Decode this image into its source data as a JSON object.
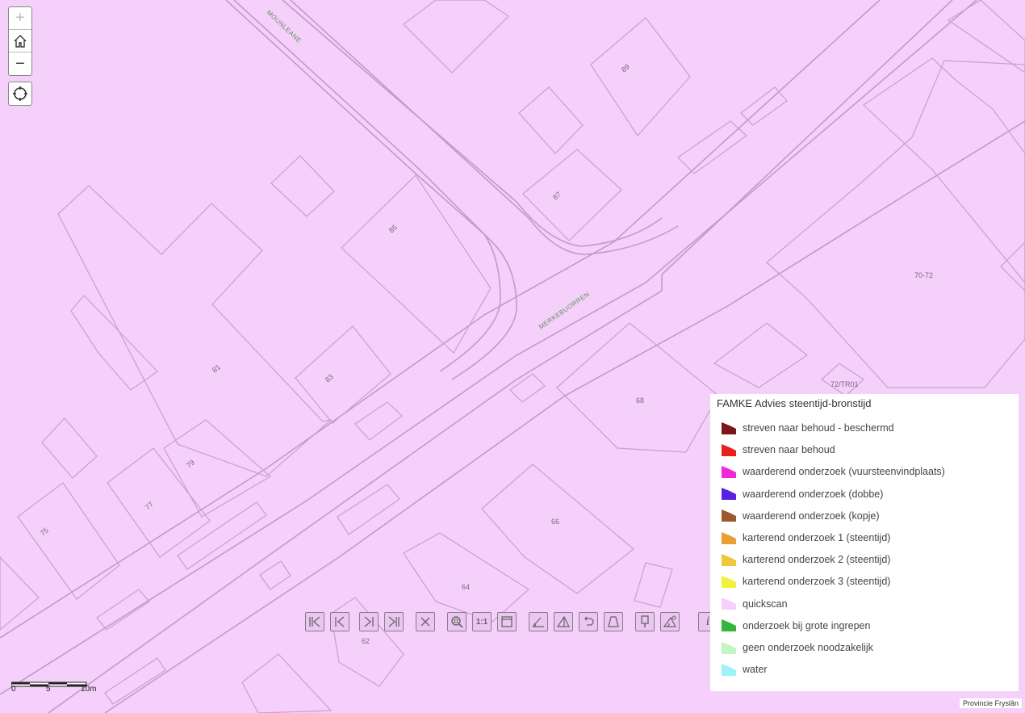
{
  "map": {
    "streets": [
      {
        "label": "MOUNLEANE"
      },
      {
        "label": "MERKEBUORREN"
      }
    ],
    "house_numbers": [
      "89",
      "87",
      "85",
      "81",
      "83",
      "79",
      "77",
      "75",
      "68",
      "66",
      "64",
      "62",
      "70-72",
      "72/TR01"
    ]
  },
  "controls": {
    "zoom_in": "+",
    "zoom_out": "−"
  },
  "toolbar": {
    "tools": [
      {
        "name": "first-extent-icon"
      },
      {
        "name": "previous-extent-icon"
      },
      {
        "name": "next-extent-icon"
      },
      {
        "name": "last-extent-icon"
      },
      {
        "name": "clear-icon"
      },
      {
        "name": "zoom-area-icon"
      },
      {
        "name": "scale-1to1-icon",
        "label": "1:1"
      },
      {
        "name": "full-extent-icon"
      },
      {
        "name": "measure-distance-icon"
      },
      {
        "name": "measure-area-icon"
      },
      {
        "name": "undo-icon"
      },
      {
        "name": "draw-polygon-icon"
      },
      {
        "name": "marker-icon"
      },
      {
        "name": "measure-angle-icon"
      },
      {
        "name": "info-icon",
        "label": "i"
      }
    ]
  },
  "legend": {
    "title": "FAMKE Advies steentijd-bronstijd",
    "items": [
      {
        "label": "streven naar behoud - beschermd",
        "color": "#7a1518"
      },
      {
        "label": "streven naar behoud",
        "color": "#e8211d"
      },
      {
        "label": "waarderend onderzoek (vuursteenvindplaats)",
        "color": "#f227d8"
      },
      {
        "label": "waarderend onderzoek (dobbe)",
        "color": "#5a1fe0"
      },
      {
        "label": "waarderend onderzoek (kopje)",
        "color": "#9a5a2e"
      },
      {
        "label": "karterend onderzoek 1 (steentijd)",
        "color": "#e8a032"
      },
      {
        "label": "karterend onderzoek 2 (steentijd)",
        "color": "#ecc83a"
      },
      {
        "label": "karterend onderzoek 3 (steentijd)",
        "color": "#eef23a"
      },
      {
        "label": "quickscan",
        "color": "#f5d0fb"
      },
      {
        "label": "onderzoek bij grote ingrepen",
        "color": "#35b53a"
      },
      {
        "label": "geen onderzoek noodzakelijk",
        "color": "#c2f5c4"
      },
      {
        "label": "water",
        "color": "#9ef3f9"
      }
    ]
  },
  "scalebar": {
    "labels": [
      "0",
      "5",
      "10m"
    ]
  },
  "attribution": "Provincie Fryslân"
}
